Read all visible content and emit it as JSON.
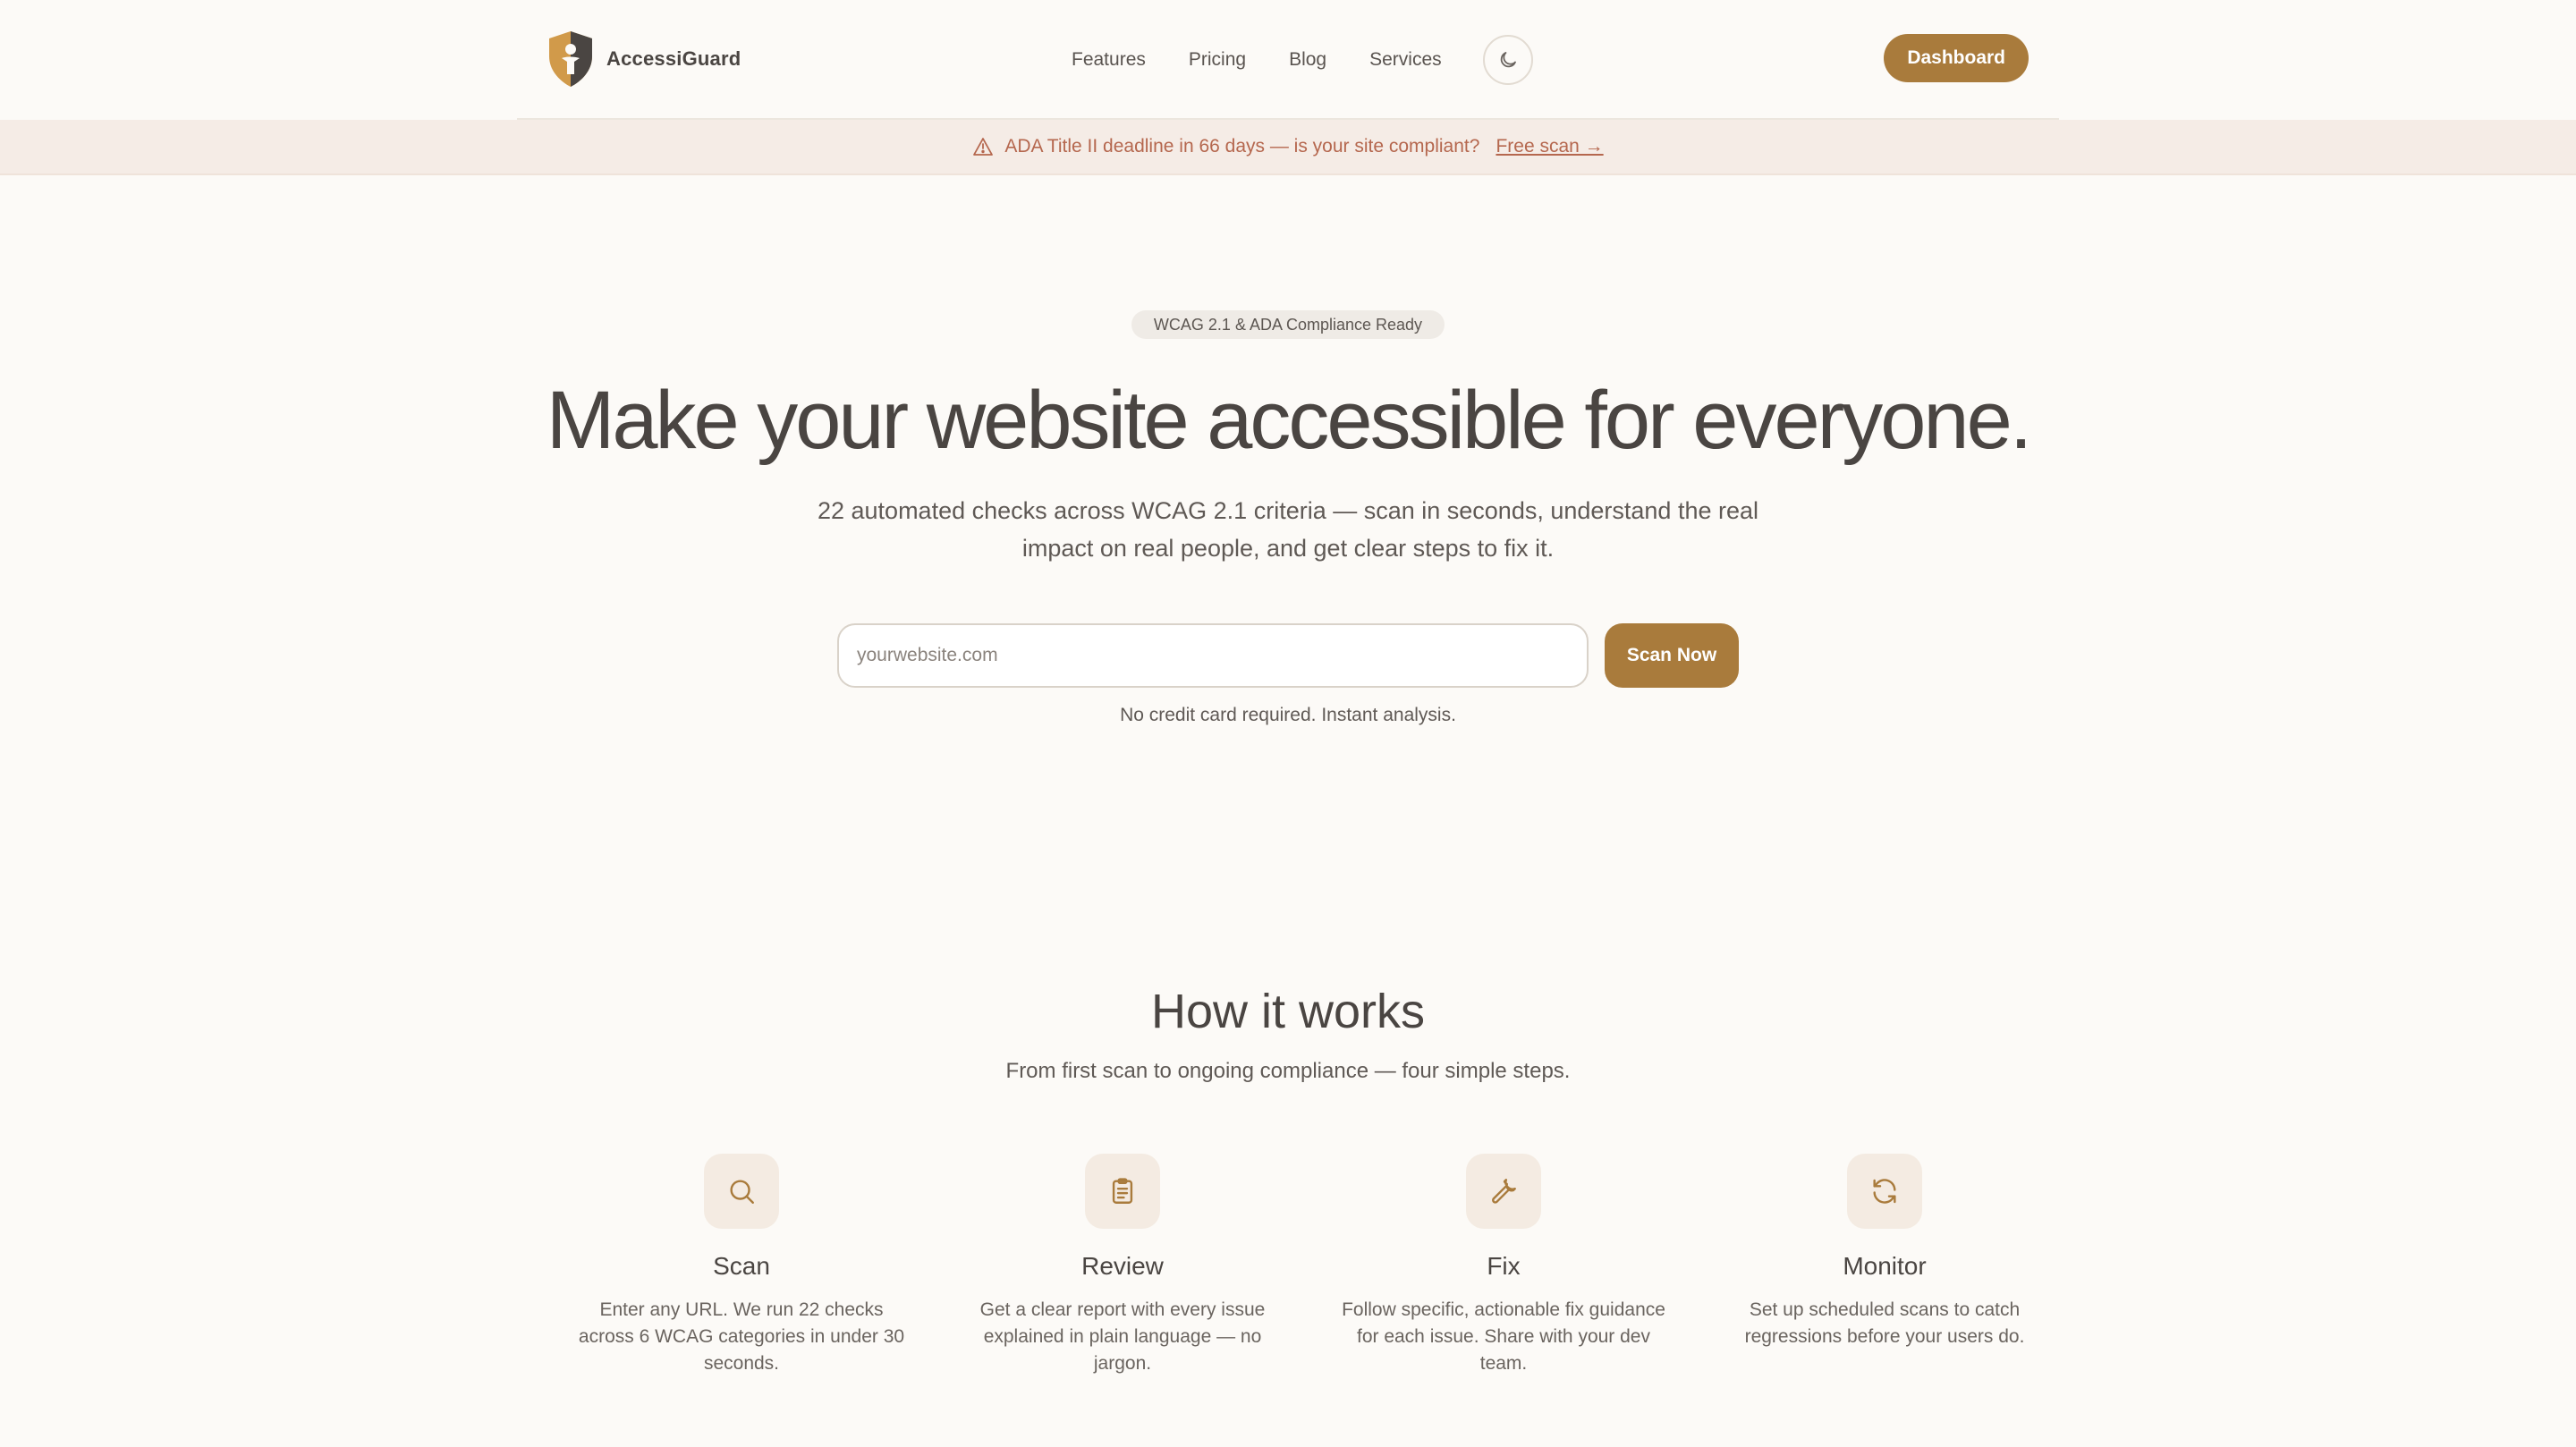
{
  "header": {
    "brand": "AccessiGuard",
    "nav": [
      "Features",
      "Pricing",
      "Blog",
      "Services"
    ],
    "dashboard_label": "Dashboard"
  },
  "banner": {
    "text": "ADA Title II deadline in 66 days — is your site compliant?",
    "link": "Free scan →"
  },
  "hero": {
    "badge": "WCAG 2.1 & ADA Compliance Ready",
    "title": "Make your website accessible for everyone.",
    "subtitle": "22 automated checks across WCAG 2.1 criteria — scan in seconds, understand the real impact on real people, and get clear steps to fix it.",
    "input_placeholder": "yourwebsite.com",
    "scan_button": "Scan Now",
    "note": "No credit card required. Instant analysis."
  },
  "how": {
    "title": "How it works",
    "subtitle": "From first scan to ongoing compliance — four simple steps.",
    "steps": [
      {
        "icon": "search-icon",
        "title": "Scan",
        "desc": "Enter any URL. We run 22 checks across 6 WCAG categories in under 30 seconds."
      },
      {
        "icon": "clipboard-icon",
        "title": "Review",
        "desc": "Get a clear report with every issue explained in plain language — no jargon."
      },
      {
        "icon": "wrench-icon",
        "title": "Fix",
        "desc": "Follow specific, actionable fix guidance for each issue. Share with your dev team."
      },
      {
        "icon": "refresh-icon",
        "title": "Monitor",
        "desc": "Set up scheduled scans to catch regressions before your users do."
      }
    ]
  },
  "colors": {
    "accent": "#a97b3c",
    "background": "#fcfaf7",
    "banner_bg": "#f5ece6",
    "banner_text": "#b5674e"
  }
}
